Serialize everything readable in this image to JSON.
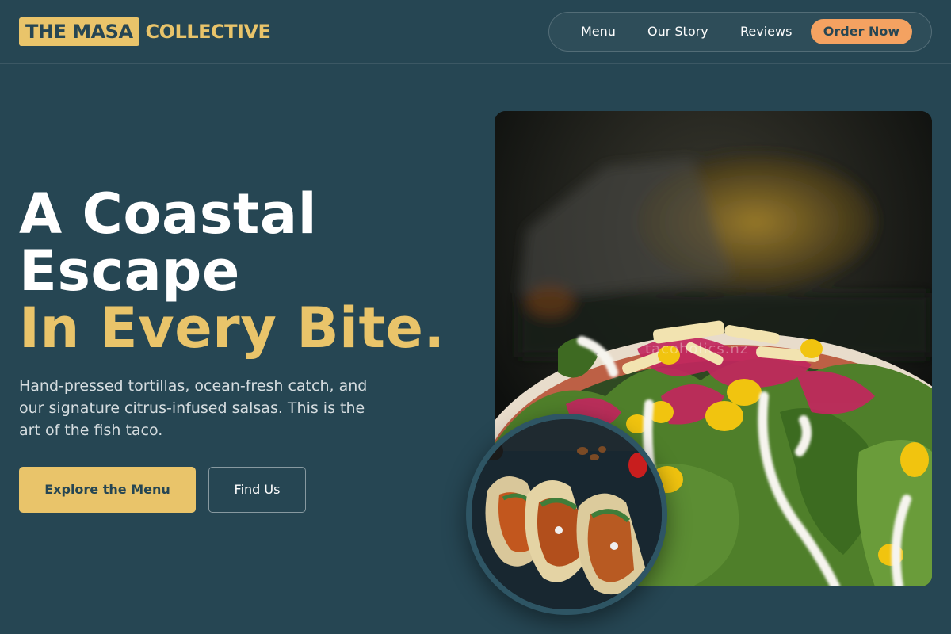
{
  "brand": {
    "logo_box": "THE MASA",
    "logo_rest": "COLLECTIVE"
  },
  "nav": {
    "menu": "Menu",
    "story": "Our Story",
    "reviews": "Reviews",
    "order": "Order Now"
  },
  "hero": {
    "line1": "A Coastal",
    "line2": "Escape",
    "line3": "In Every Bite.",
    "lede": "Hand-pressed tortillas, ocean-fresh catch, and our signature citrus-infused salsas. This is the art of the fish taco.",
    "primary_cta": "Explore the Menu",
    "secondary_cta": "Find Us",
    "watermark": "tacoholics.nz"
  },
  "colors": {
    "background": "#264653",
    "accent": "#e9c46a",
    "cta_orange": "#f4a261"
  }
}
